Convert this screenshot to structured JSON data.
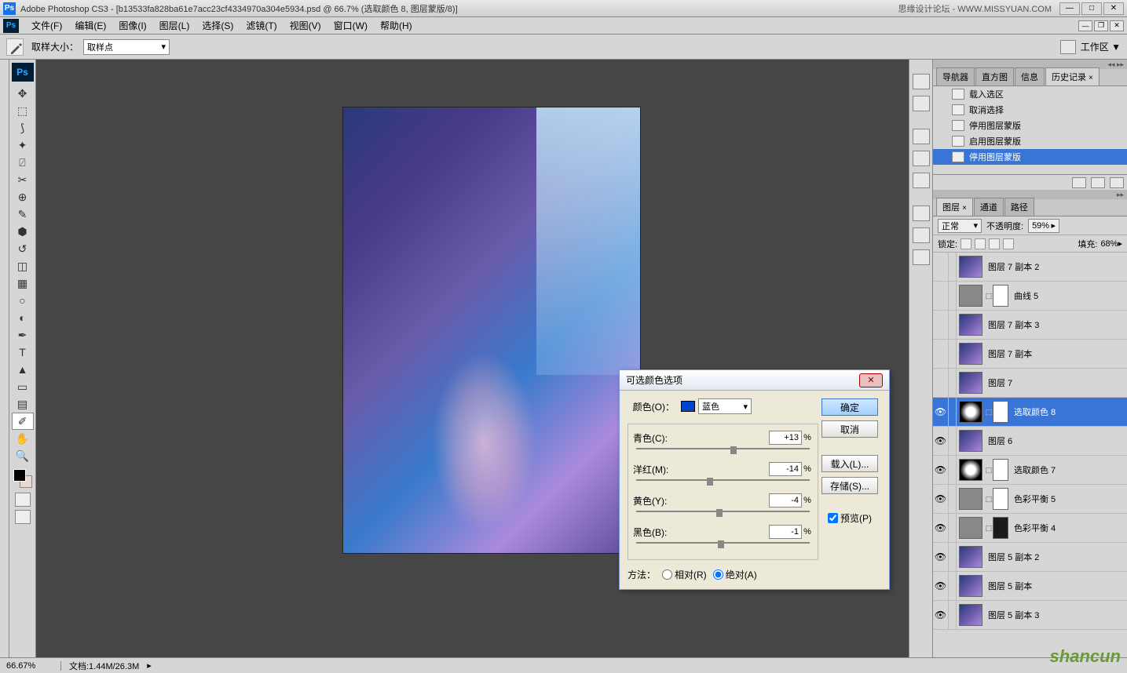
{
  "titlebar": {
    "title": "Adobe Photoshop CS3 - [b13533fa828ba61e7acc23cf4334970a304e5934.psd @ 66.7% (选取颜色 8, 图层蒙版/8)]",
    "ad": "思缘设计论坛 - WWW.MISSYUAN.COM"
  },
  "menu": {
    "file": "文件(F)",
    "edit": "编辑(E)",
    "image": "图像(I)",
    "layer": "图层(L)",
    "select": "选择(S)",
    "filter": "滤镜(T)",
    "view": "视图(V)",
    "window": "窗口(W)",
    "help": "帮助(H)"
  },
  "options": {
    "sample_label": "取样大小：",
    "sample_value": "取样点",
    "workspace": "工作区 ▼"
  },
  "dialog": {
    "title": "可选颜色选项",
    "color_label": "颜色(O)：",
    "color_value": "蓝色",
    "cyan_label": "青色(C):",
    "cyan_value": "+13",
    "magenta_label": "洋红(M):",
    "magenta_value": "-14",
    "yellow_label": "黄色(Y):",
    "yellow_value": "-4",
    "black_label": "黑色(B):",
    "black_value": "-1",
    "pct": "%",
    "method_label": "方法：",
    "relative": "相对(R)",
    "absolute": "绝对(A)",
    "ok": "确定",
    "cancel": "取消",
    "load": "载入(L)...",
    "save": "存储(S)...",
    "preview": "预览(P)"
  },
  "history": {
    "tabs": {
      "navigator": "导航器",
      "histogram": "直方图",
      "info": "信息",
      "history": "历史记录"
    },
    "items": [
      "载入选区",
      "取消选择",
      "停用图层蒙版",
      "启用图层蒙版",
      "停用图层蒙版"
    ]
  },
  "layers": {
    "tabs": {
      "layers": "图层",
      "channels": "通道",
      "paths": "路径"
    },
    "blend": "正常",
    "opacity_label": "不透明度:",
    "opacity": "59%",
    "lock_label": "锁定:",
    "fill_label": "填充:",
    "fill": "68%",
    "items": [
      {
        "name": "图层 7 副本 2",
        "eye": false,
        "thumb": "img"
      },
      {
        "name": "曲线 5",
        "eye": false,
        "thumb": "adj",
        "mask": true,
        "linkadj": true
      },
      {
        "name": "图层 7 副本 3",
        "eye": false,
        "thumb": "img"
      },
      {
        "name": "图层 7 副本",
        "eye": false,
        "thumb": "img"
      },
      {
        "name": "图层 7",
        "eye": false,
        "thumb": "img"
      },
      {
        "name": "选取颜色 8",
        "eye": true,
        "thumb": "adj2",
        "mask": true,
        "active": true,
        "linkadj": true
      },
      {
        "name": "图层 6",
        "eye": true,
        "thumb": "img"
      },
      {
        "name": "选取颜色 7",
        "eye": true,
        "thumb": "adj2",
        "mask": true,
        "linkadj": true
      },
      {
        "name": "色彩平衡 5",
        "eye": true,
        "thumb": "adj",
        "mask": true,
        "linkadj": true
      },
      {
        "name": "色彩平衡 4",
        "eye": true,
        "thumb": "adj",
        "mask": "dark",
        "linkadj": true
      },
      {
        "name": "图层 5 副本 2",
        "eye": true,
        "thumb": "img"
      },
      {
        "name": "图层 5 副本",
        "eye": true,
        "thumb": "img"
      },
      {
        "name": "图层 5 副本 3",
        "eye": true,
        "thumb": "img"
      }
    ]
  },
  "status": {
    "zoom": "66.67%",
    "doc": "文档:1.44M/26.3M"
  },
  "watermark": "shancun"
}
